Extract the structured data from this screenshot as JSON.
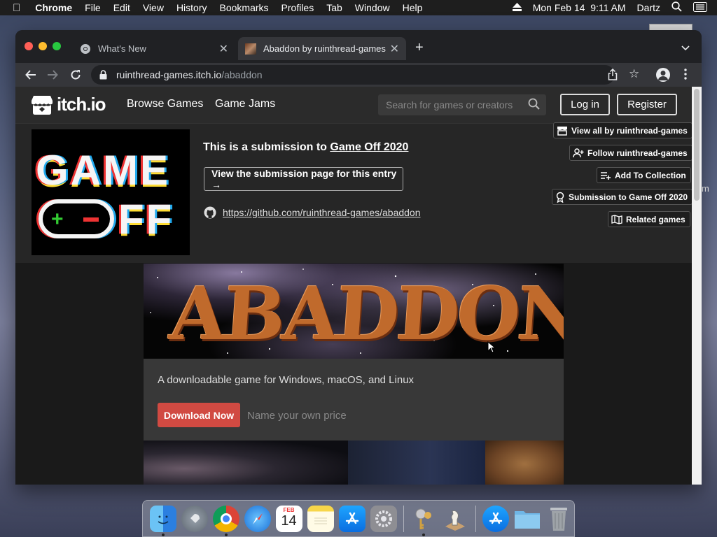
{
  "menubar": {
    "apple": "",
    "app_name": "Chrome",
    "items": [
      "File",
      "Edit",
      "View",
      "History",
      "Bookmarks",
      "Profiles",
      "Tab",
      "Window",
      "Help"
    ],
    "datetime": "Mon Feb 14  9:11 AM",
    "user": "Dartz"
  },
  "desktop": {
    "partial_text": "m"
  },
  "browser": {
    "tabs": [
      {
        "title": "What's New",
        "active": false
      },
      {
        "title": "Abaddon by ruinthread-games",
        "active": true
      }
    ],
    "url": {
      "host": "ruinthread-games.itch.io",
      "path": "/abaddon"
    }
  },
  "itch": {
    "logo_text": "itch.io",
    "nav": [
      "Browse Games",
      "Game Jams"
    ],
    "search_placeholder": "Search for games or creators",
    "login": "Log in",
    "register": "Register",
    "jam_banner": {
      "image_text_top": "GAME",
      "image_text_bottom": "FF",
      "title_prefix": "This is a submission to ",
      "jam_name": "Game Off 2020",
      "submission_button": "View the submission page for this entry →",
      "github_link": "https://github.com/ruinthread-games/abaddon"
    },
    "side_buttons": [
      {
        "label": "View all by ruinthread-games",
        "icon": "store-icon"
      },
      {
        "label": "Follow ruinthread-games",
        "icon": "user-plus-icon"
      },
      {
        "label": "Add To Collection",
        "icon": "list-add-icon"
      },
      {
        "label": "Submission to Game Off 2020",
        "icon": "award-icon"
      },
      {
        "label": "Related games",
        "icon": "map-icon"
      }
    ],
    "game": {
      "banner_text": "ABADDON",
      "description": "A downloadable game for Windows, macOS, and Linux",
      "download_button": "Download Now",
      "price_placeholder": "Name your own price"
    }
  },
  "dock": {
    "apps": [
      "Finder",
      "Launchpad",
      "Google Chrome",
      "Safari",
      "Calendar",
      "Notes",
      "App Store",
      "System Preferences",
      "Keychain Access",
      "Chess",
      "App Store",
      "Downloads",
      "Trash"
    ],
    "calendar_month": "FEB",
    "calendar_day": "14"
  },
  "colors": {
    "download_button": "#d14a42",
    "page_bg": "#1a1a1a",
    "header_bg": "#2b2b2b"
  }
}
